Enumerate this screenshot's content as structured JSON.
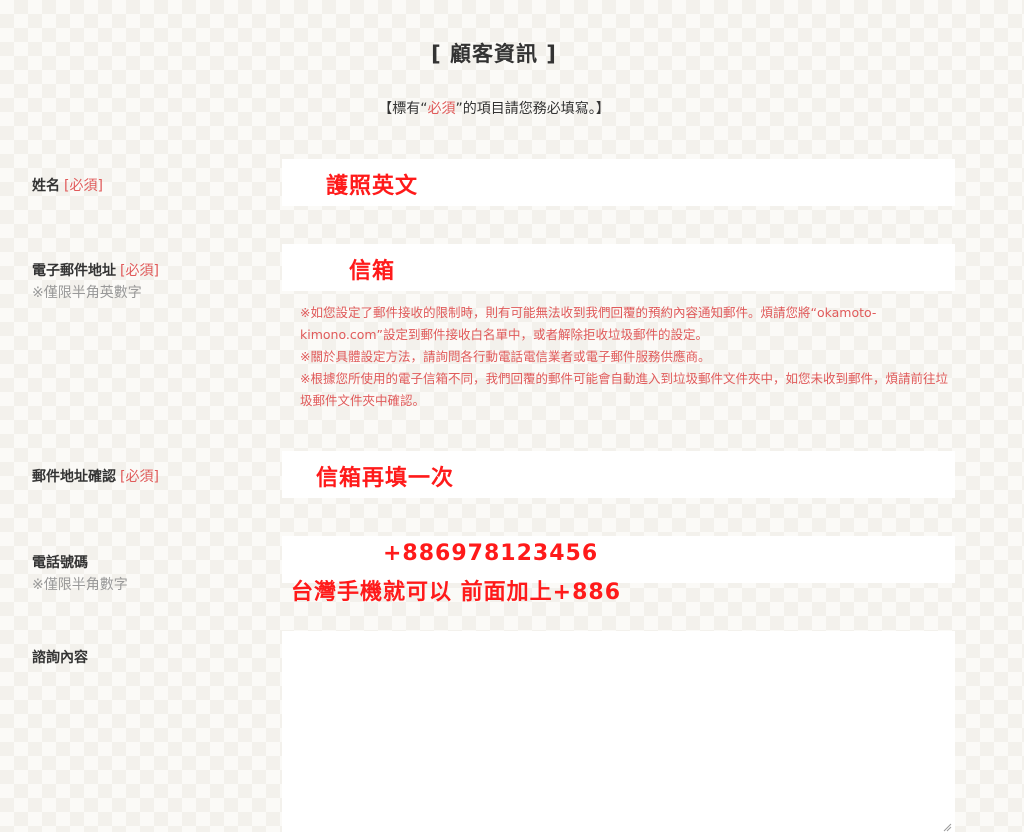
{
  "header": {
    "title": "[ 顧客資訊 ]",
    "note_prefix": "【標有“",
    "note_required": "必須",
    "note_suffix": "”的項目請您務必填寫。】"
  },
  "fields": {
    "name": {
      "label": "姓名",
      "required": "[必須]",
      "annotation": "護照英文"
    },
    "email": {
      "label": "電子郵件地址",
      "required": "[必須]",
      "sublabel": "※僅限半角英數字",
      "annotation": "信箱"
    },
    "email_confirm": {
      "label": "郵件地址確認",
      "required": "[必須]",
      "annotation": "信箱再填一次"
    },
    "phone": {
      "label": "電話號碼",
      "sublabel": "※僅限半角數字",
      "annotation_number": "+886978123456",
      "annotation_hint": "台灣手機就可以  前面加上+886"
    },
    "inquiry": {
      "label": "諮詢內容"
    }
  },
  "email_notes": [
    "※如您設定了郵件接收的限制時，則有可能無法收到我們回覆的預約內容通知郵件。煩請您將“okamoto-kimono.com”設定到郵件接收白名單中，或者解除拒收垃圾郵件的設定。",
    "※關於具體設定方法，請詢問各行動電話電信業者或電子郵件服務供應商。",
    "※根據您所使用的電子信箱不同，我們回覆的郵件可能會自動進入到垃圾郵件文件夾中，如您未收到郵件，煩請前往垃圾郵件文件夾中確認。"
  ],
  "colors": {
    "required": "#e05a5a",
    "annotation": "#ff1a1a",
    "field_bg": "#ffffff"
  }
}
